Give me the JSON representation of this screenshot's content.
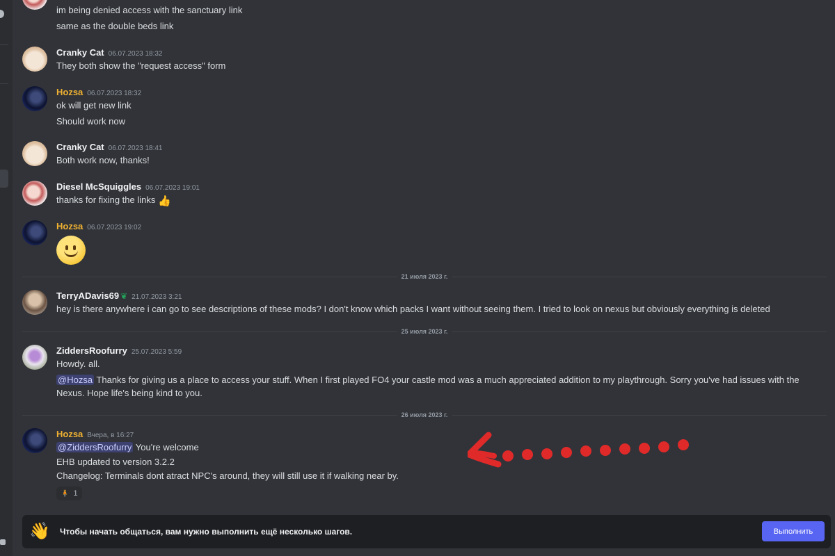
{
  "messages": {
    "m0": {
      "line1": "im being denied access with the sanctuary link",
      "line2": "same as the double beds link"
    },
    "m1": {
      "author": "Cranky Cat",
      "time": "06.07.2023 18:32",
      "line1": "They both show the \"request access\" form"
    },
    "m2": {
      "author": "Hozsa",
      "time": "06.07.2023 18:32",
      "line1": "ok will get new link",
      "line2": "Should work now"
    },
    "m3": {
      "author": "Cranky Cat",
      "time": "06.07.2023 18:41",
      "line1": "Both work now, thanks!"
    },
    "m4": {
      "author": "Diesel McSquiggles",
      "time": "06.07.2023 19:01",
      "line1": "thanks for fixing the links",
      "emoji": "👍"
    },
    "m5": {
      "author": "Hozsa",
      "time": "06.07.2023 19:02",
      "emoji_name": "slight-smile-emoji"
    },
    "m6": {
      "author": "TerryADavis69",
      "badge": "❦",
      "time": "21.07.2023 3:21",
      "line1": "hey is there anywhere i can go to see descriptions of these mods? I don't know which packs I want without seeing them. I tried to look on nexus but obviously everything is deleted"
    },
    "m7": {
      "author": "ZiddersRoofurry",
      "time": "25.07.2023 5:59",
      "line1": "Howdy. all.",
      "mention": "@Hozsa",
      "line2": " Thanks for giving us a place to access your stuff. When I first played FO4 your castle mod was a much appreciated addition to my playthrough. Sorry you've had issues with the Nexus. Hope life's being kind to you."
    },
    "m8": {
      "author": "Hozsa",
      "time": "Вчера, в 16:27",
      "mention": "@ZiddersRoofurry",
      "line1": " You're welcome",
      "line2": "EHB updated to version 3.2.2",
      "line3": "Changelog: Terminals dont atract NPC's around, they will still use it if walking near by.",
      "reaction_count": "1"
    }
  },
  "dividers": {
    "d1": "21 июля 2023 г.",
    "d2": "25 июля 2023 г.",
    "d3": "26 июля 2023 г."
  },
  "onboarding": {
    "icon": "👋",
    "text": "Чтобы начать общаться, вам нужно выполнить ещё несколько шагов.",
    "button": "Выполнить"
  },
  "colors": {
    "background": "#313338",
    "accent": "#5865f2",
    "gold_name": "#f0b232",
    "annotation": "#e02a2a"
  }
}
